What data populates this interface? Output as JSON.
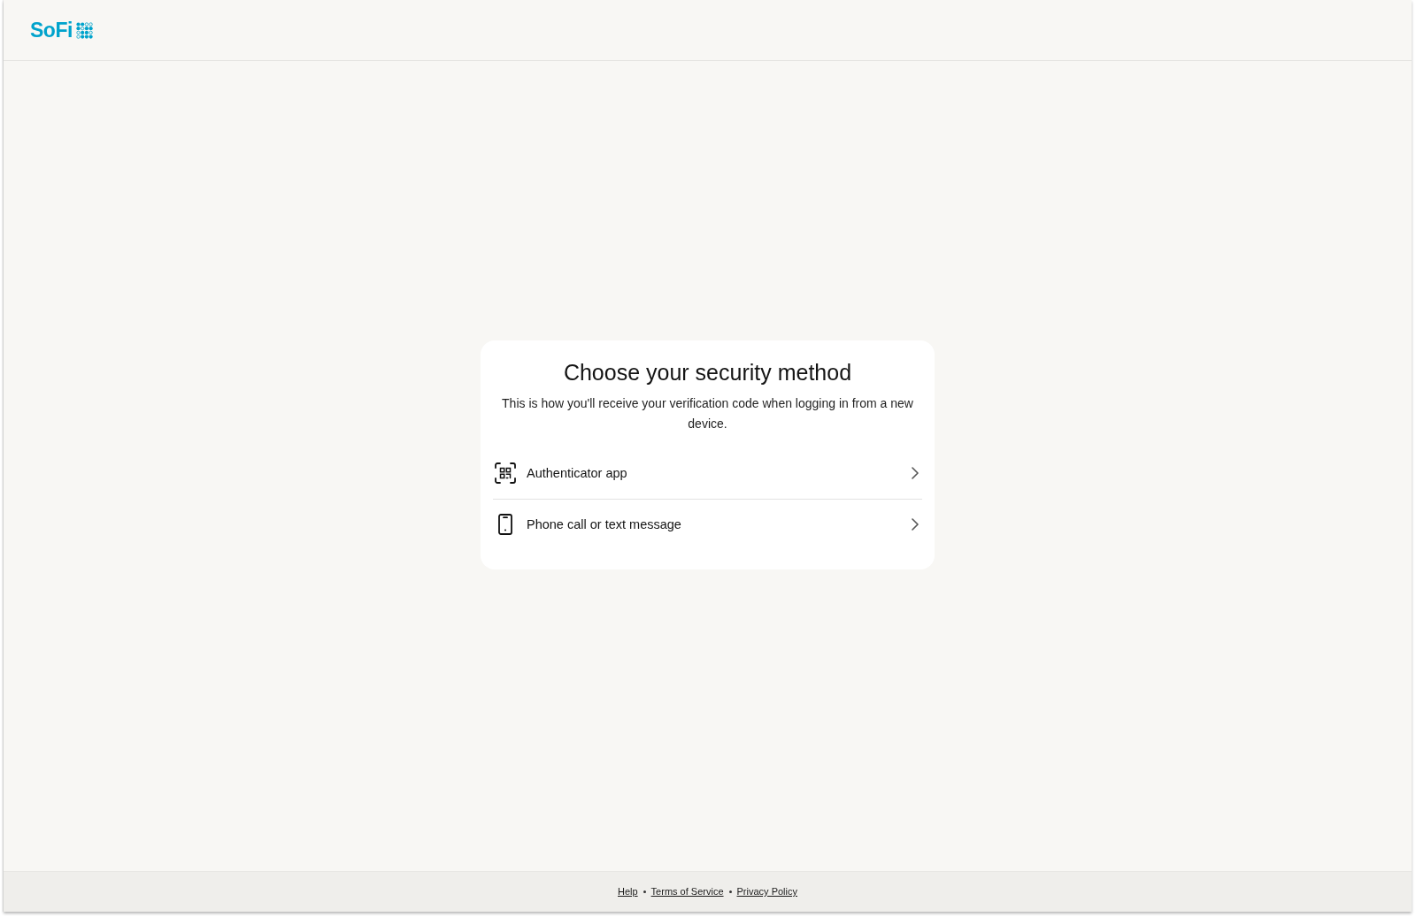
{
  "header": {
    "logo": {
      "text": "SoFi"
    }
  },
  "card": {
    "title": "Choose your security method",
    "subtitle": "This is how you'll receive your verification code when logging in from a new device.",
    "options": [
      {
        "kind": "authenticator",
        "label": "Authenticator app"
      },
      {
        "kind": "phone",
        "label": "Phone call or text message"
      }
    ]
  },
  "footer": {
    "links": [
      "Help",
      "Terms of Service",
      "Privacy Policy"
    ]
  }
}
